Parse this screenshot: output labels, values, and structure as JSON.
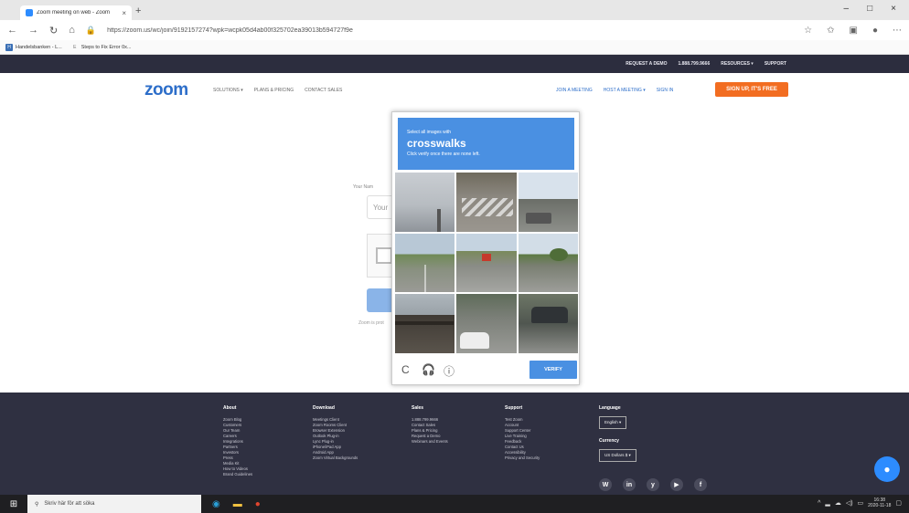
{
  "browser": {
    "tab_title": "Zoom meeting on web - Zoom",
    "tab_close": "×",
    "new_tab": "+",
    "window_controls": [
      "–",
      "□",
      "×"
    ],
    "nav": {
      "back": "←",
      "forward": "→",
      "refresh": "↻",
      "home": "⌂"
    },
    "url": "https://zoom.us/wc/join/9192157274?wpk=wcpk05d4ab00f325702ea39013b594727f9e",
    "bookmarks": [
      {
        "icon": "H",
        "label": "Handelsbanken - L..."
      },
      {
        "icon": "E",
        "label": "Steps to Fix Error 0x..."
      }
    ]
  },
  "zoom_topbar": {
    "items": [
      "REQUEST A DEMO",
      "1.888.799.9666",
      "RESOURCES ▾",
      "SUPPORT"
    ]
  },
  "zoom_nav": {
    "logo": "zoom",
    "left": [
      "SOLUTIONS ▾",
      "PLANS & PRICING",
      "CONTACT SALES"
    ],
    "right": [
      "JOIN A MEETING",
      "HOST A MEETING ▾",
      "SIGN IN"
    ],
    "signup": "SIGN UP, IT'S FREE"
  },
  "join_form": {
    "name_label": "Your Nam",
    "name_placeholder": "Your",
    "zoom_is": "Zoom is prot"
  },
  "captcha": {
    "instruction_small": "Select all images with",
    "target": "crosswalks",
    "instruction_sub": "Click verify once there are none left.",
    "verify": "VERIFY",
    "icons": {
      "reload": "C",
      "audio": "🎧",
      "info": "ⓘ"
    }
  },
  "footer": {
    "columns": [
      {
        "header": "About",
        "items": [
          "Zoom Blog",
          "Customers",
          "Our Team",
          "Careers",
          "Integrations",
          "Partners",
          "Investors",
          "Press",
          "Media Kit",
          "How to Videos",
          "Brand Guidelines"
        ]
      },
      {
        "header": "Download",
        "items": [
          "Meetings Client",
          "Zoom Rooms Client",
          "Browser Extension",
          "Outlook Plug-in",
          "Lync Plug-in",
          "iPhone/iPad App",
          "Android App",
          "Zoom Virtual Backgrounds"
        ]
      },
      {
        "header": "Sales",
        "items": [
          "1.888.799.9666",
          "Contact Sales",
          "Plans & Pricing",
          "Request a Demo",
          "Webinars and Events"
        ]
      },
      {
        "header": "Support",
        "items": [
          "Test Zoom",
          "Account",
          "Support Center",
          "Live Training",
          "Feedback",
          "Contact Us",
          "Accessibility",
          "Privacy and Security"
        ]
      }
    ],
    "language_label": "Language",
    "language_value": "English ▾",
    "currency_label": "Currency",
    "currency_value": "US Dollars $ ▾",
    "social": [
      "W",
      "in",
      "y",
      "▶",
      "f"
    ]
  },
  "taskbar": {
    "search_placeholder": "Skriv här för att söka",
    "time": "16:38",
    "date": "2020-11-18"
  }
}
